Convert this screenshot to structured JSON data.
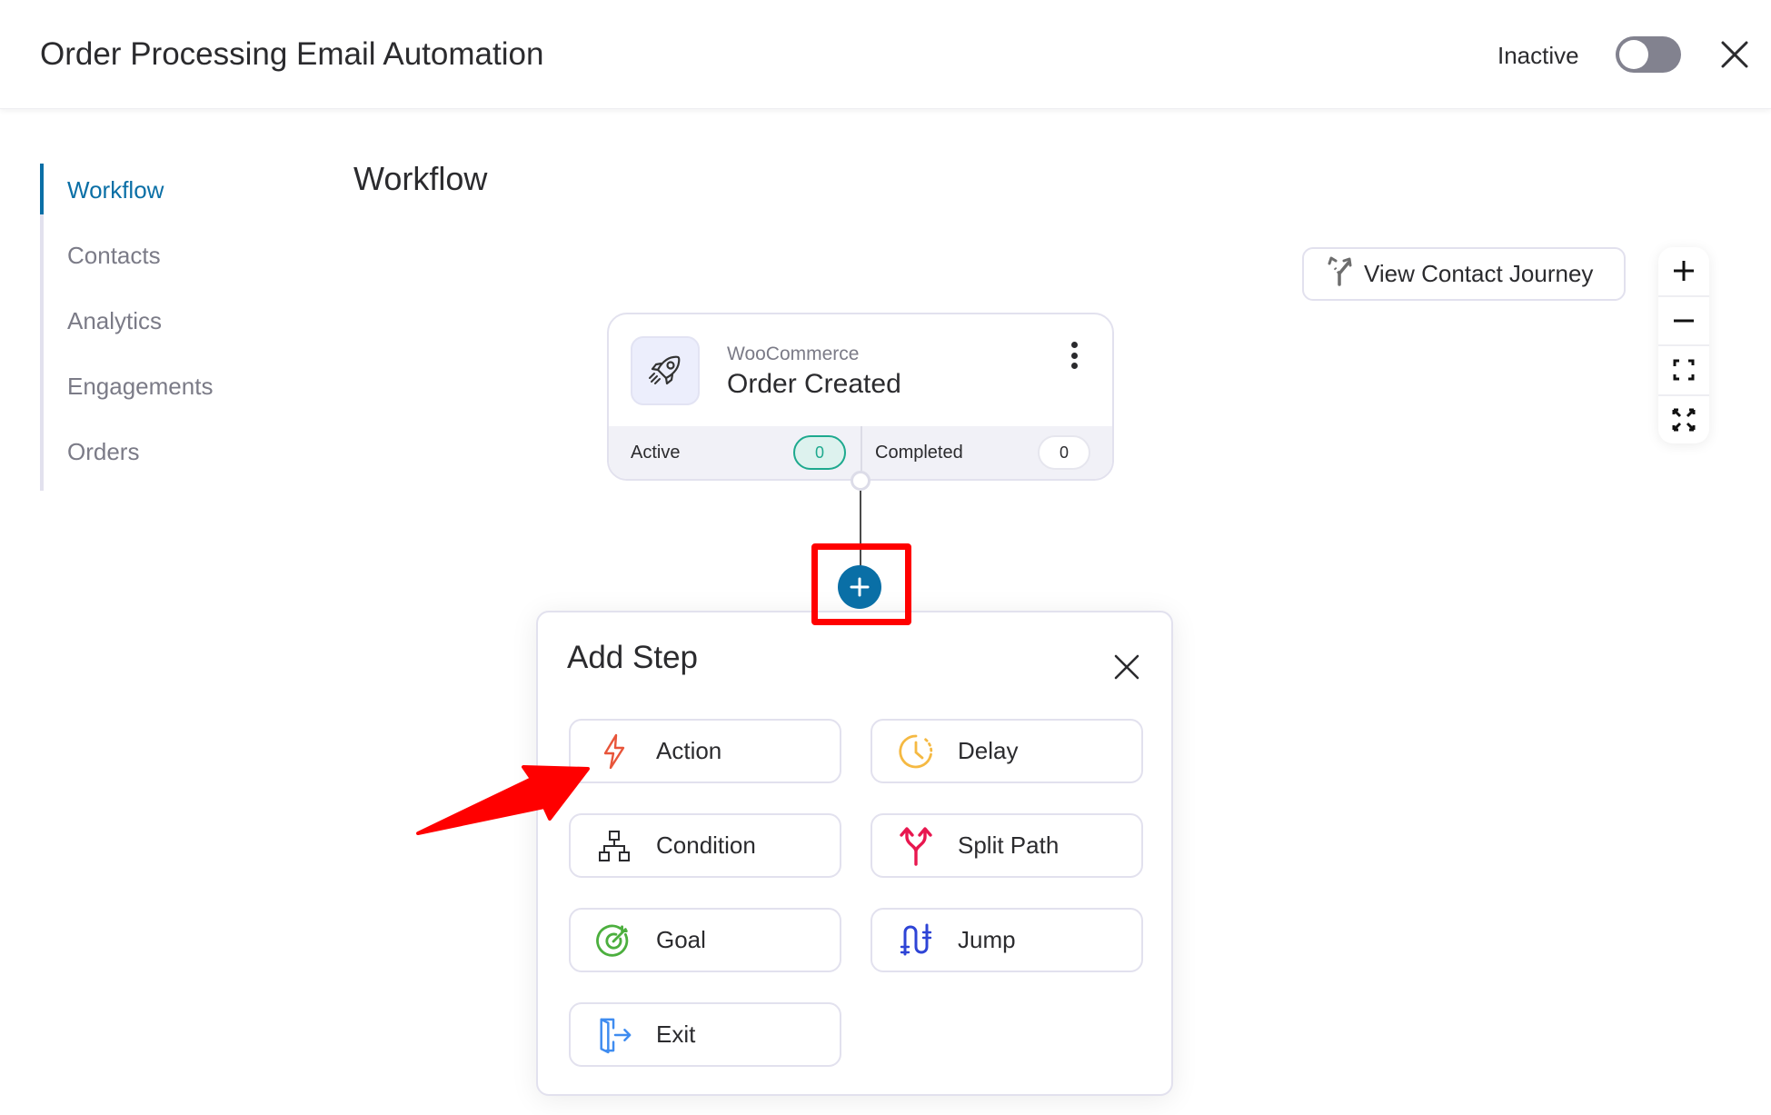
{
  "header": {
    "title": "Order Processing Email Automation",
    "status_label": "Inactive",
    "toggle_on": false
  },
  "sidebar": {
    "items": [
      {
        "label": "Workflow",
        "active": true
      },
      {
        "label": "Contacts",
        "active": false
      },
      {
        "label": "Analytics",
        "active": false
      },
      {
        "label": "Engagements",
        "active": false
      },
      {
        "label": "Orders",
        "active": false
      }
    ]
  },
  "main": {
    "title": "Workflow",
    "journey_button": "View Contact Journey",
    "zoom_controls": [
      "zoom-in",
      "zoom-out",
      "fit-view",
      "fullscreen"
    ]
  },
  "trigger": {
    "provider": "WooCommerce",
    "event": "Order Created",
    "icon": "rocket-icon",
    "stats": {
      "active_label": "Active",
      "active_value": "0",
      "completed_label": "Completed",
      "completed_value": "0"
    }
  },
  "add_step": {
    "title": "Add Step",
    "options": [
      {
        "label": "Action",
        "icon": "lightning-icon",
        "color": "#e8553a"
      },
      {
        "label": "Delay",
        "icon": "clock-icon",
        "color": "#f5b942"
      },
      {
        "label": "Condition",
        "icon": "hierarchy-icon",
        "color": "#2b2b2e"
      },
      {
        "label": "Split Path",
        "icon": "split-icon",
        "color": "#e8174f"
      },
      {
        "label": "Goal",
        "icon": "target-icon",
        "color": "#4caf3e"
      },
      {
        "label": "Jump",
        "icon": "jump-icon",
        "color": "#2e44d6"
      },
      {
        "label": "Exit",
        "icon": "exit-door-icon",
        "color": "#3f8cf0"
      }
    ]
  },
  "colors": {
    "accent": "#0a6fa6",
    "annotation": "#ff0000",
    "active_pill": "#1ea98e"
  }
}
